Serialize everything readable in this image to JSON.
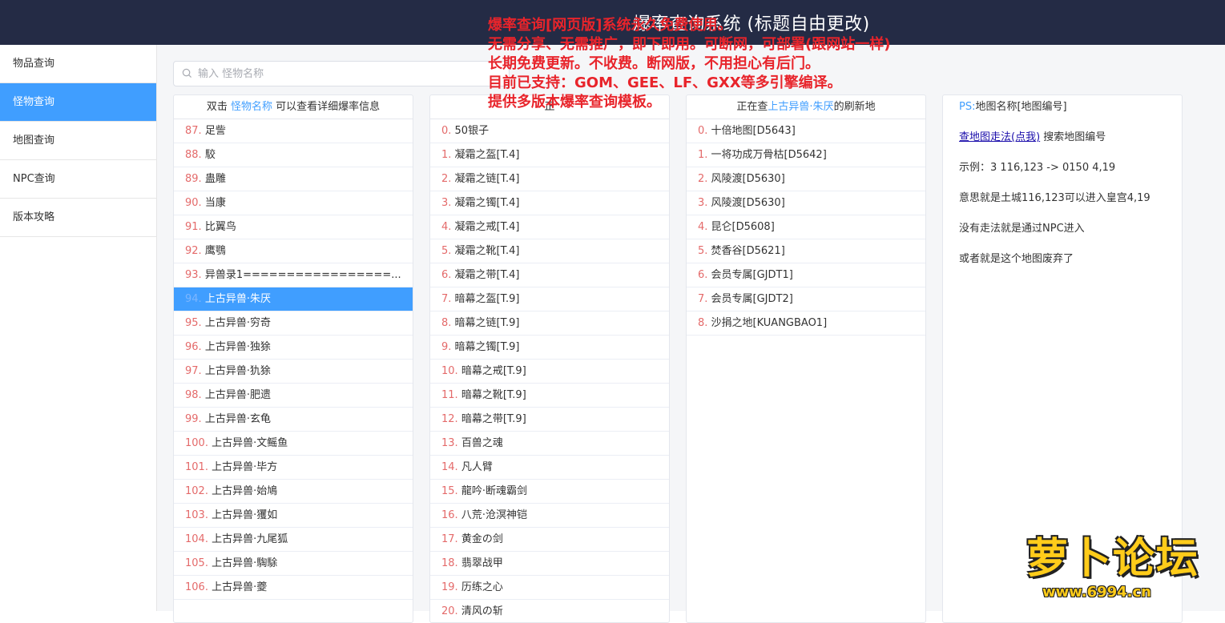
{
  "header": {
    "title": "爆率查询系统 (标题自由更改)"
  },
  "sidebar": {
    "items": [
      {
        "label": "物品查询",
        "active": false
      },
      {
        "label": "怪物查询",
        "active": true
      },
      {
        "label": "地图查询",
        "active": false
      },
      {
        "label": "NPC查询",
        "active": false
      },
      {
        "label": "版本攻略",
        "active": false
      }
    ]
  },
  "search": {
    "placeholder": "输入 怪物名称",
    "value": ""
  },
  "monster_panel": {
    "head_prefix": "双击",
    "head_link": "怪物名称",
    "head_suffix": "可以查看详细爆率信息",
    "selected_index": 94,
    "rows": [
      {
        "num": "87.",
        "name": "足訾"
      },
      {
        "num": "88.",
        "name": "駮"
      },
      {
        "num": "89.",
        "name": "蛊雕"
      },
      {
        "num": "90.",
        "name": "当康"
      },
      {
        "num": "91.",
        "name": "比翼鸟"
      },
      {
        "num": "92.",
        "name": "鹰鶚"
      },
      {
        "num": "93.",
        "name": "异兽录1=================..."
      },
      {
        "num": "94.",
        "name": "上古异兽·朱厌"
      },
      {
        "num": "95.",
        "name": "上古异兽·穷奇"
      },
      {
        "num": "96.",
        "name": "上古异兽·独狳"
      },
      {
        "num": "97.",
        "name": "上古异兽·犰狳"
      },
      {
        "num": "98.",
        "name": "上古异兽·肥遗"
      },
      {
        "num": "99.",
        "name": "上古异兽·玄龟"
      },
      {
        "num": "100.",
        "name": "上古异兽·文鳐鱼"
      },
      {
        "num": "101.",
        "name": "上古异兽·毕方"
      },
      {
        "num": "102.",
        "name": "上古异兽·始鳩"
      },
      {
        "num": "103.",
        "name": "上古异兽·玃如"
      },
      {
        "num": "104.",
        "name": "上古异兽·九尾狐"
      },
      {
        "num": "105.",
        "name": "上古异兽·騊駼"
      },
      {
        "num": "106.",
        "name": "上古异兽·夔"
      }
    ]
  },
  "drops_panel": {
    "head": "正",
    "rows": [
      {
        "num": "0.",
        "name": "50银子"
      },
      {
        "num": "1.",
        "name": "凝霜之盔[T.4]"
      },
      {
        "num": "2.",
        "name": "凝霜之链[T.4]"
      },
      {
        "num": "3.",
        "name": "凝霜之镯[T.4]"
      },
      {
        "num": "4.",
        "name": "凝霜之戒[T.4]"
      },
      {
        "num": "5.",
        "name": "凝霜之靴[T.4]"
      },
      {
        "num": "6.",
        "name": "凝霜之带[T.4]"
      },
      {
        "num": "7.",
        "name": "暗幕之盔[T.9]"
      },
      {
        "num": "8.",
        "name": "暗幕之链[T.9]"
      },
      {
        "num": "9.",
        "name": "暗幕之镯[T.9]"
      },
      {
        "num": "10.",
        "name": "暗幕之戒[T.9]"
      },
      {
        "num": "11.",
        "name": "暗幕之靴[T.9]"
      },
      {
        "num": "12.",
        "name": "暗幕之带[T.9]"
      },
      {
        "num": "13.",
        "name": "百兽之魂"
      },
      {
        "num": "14.",
        "name": "凡人臂"
      },
      {
        "num": "15.",
        "name": "龍吟·断魂霸剑"
      },
      {
        "num": "16.",
        "name": "八荒·沧溟神铠"
      },
      {
        "num": "17.",
        "name": "黄金の剑"
      },
      {
        "num": "18.",
        "name": "翡翠战甲"
      },
      {
        "num": "19.",
        "name": "历练之心"
      },
      {
        "num": "20.",
        "name": "清风の斩"
      }
    ]
  },
  "maps_panel": {
    "head_prefix": "正在查",
    "head_link": "上古异兽·朱厌",
    "head_suffix": "的刷新地",
    "rows": [
      {
        "num": "0.",
        "name": "十倍地图[D5643]"
      },
      {
        "num": "1.",
        "name": "一将功成万骨枯[D5642]"
      },
      {
        "num": "2.",
        "name": "风陵渡[D5630]"
      },
      {
        "num": "3.",
        "name": "风陵渡[D5630]"
      },
      {
        "num": "4.",
        "name": "昆仑[D5608]"
      },
      {
        "num": "5.",
        "name": "焚香谷[D5621]"
      },
      {
        "num": "6.",
        "name": "会员专属[GJDT1]"
      },
      {
        "num": "7.",
        "name": "会员专属[GJDT2]"
      },
      {
        "num": "8.",
        "name": "沙捐之地[KUANGBAO1]"
      }
    ]
  },
  "info_panel": {
    "ps_label": "PS:",
    "ps_text": "地图名称[地图编号]",
    "link_text": "查地图走法(点我)",
    "link_suffix": "搜索地图编号",
    "example": "示例：3 116,123 -> 0150 4,19",
    "meaning": "意思就是土城116,123可以进入皇宫4,19",
    "no_route": "没有走法就是通过NPC进入",
    "abandoned": "或者就是这个地图废弃了"
  },
  "promo": [
    "爆率查询[网页版]系统永久免费使用。",
    "无需分享、无需推广，即下即用。可断网，可部署(跟网站一样)",
    "长期免费更新。不收费。断网版，不用担心有后门。",
    "目前已支持：GOM、GEE、LF、GXX等多引擎编译。",
    "提供多版本爆率查询模板。"
  ],
  "watermark": {
    "text": "萝卜论坛",
    "domain": "www.6994.cn"
  },
  "colors": {
    "accent": "#409eff",
    "topbar": "#242b45",
    "number": "#e46a6a",
    "promo": "#e8242b"
  }
}
